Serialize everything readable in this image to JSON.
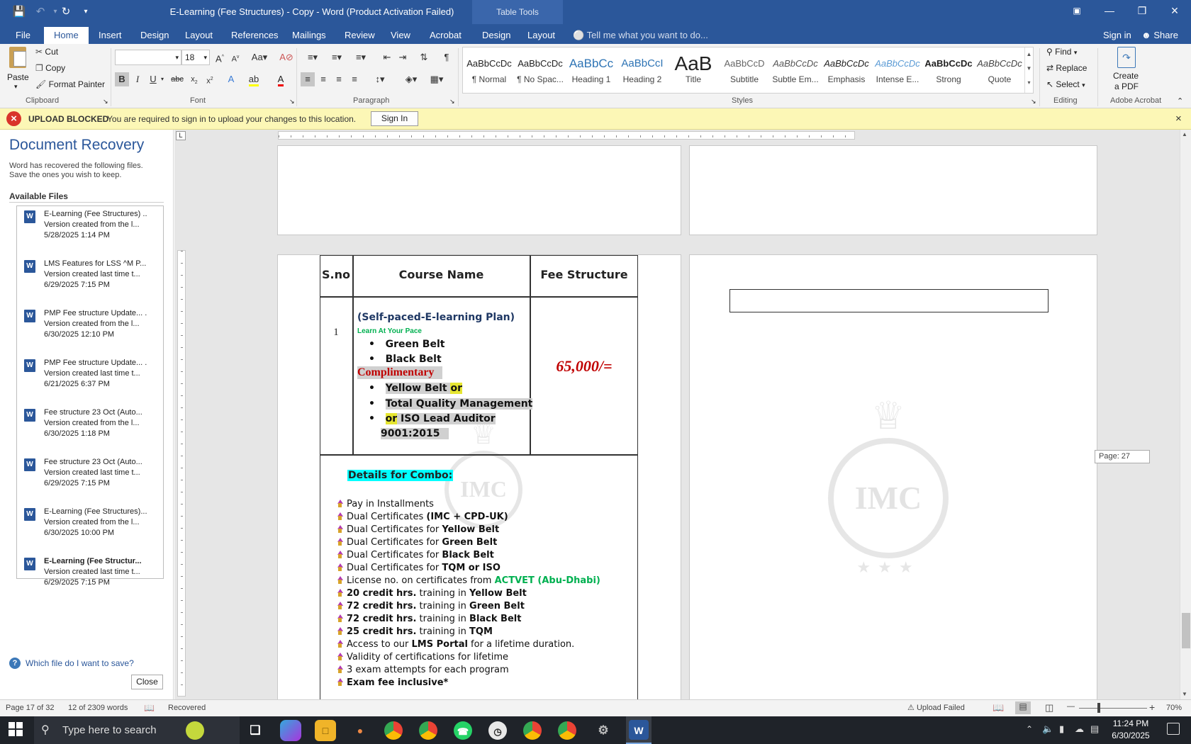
{
  "window": {
    "title": "E-Learning (Fee Structures) - Copy - Word (Product Activation Failed)",
    "table_tools": "Table Tools"
  },
  "tabs": [
    "File",
    "Home",
    "Insert",
    "Design",
    "Layout",
    "References",
    "Mailings",
    "Review",
    "View",
    "Acrobat",
    "Design",
    "Layout"
  ],
  "tell_me": "Tell me what you want to do...",
  "sign_in": "Sign in",
  "share": "Share",
  "clipboard": {
    "paste": "Paste",
    "cut": "Cut",
    "copy": "Copy",
    "format_painter": "Format Painter",
    "label": "Clipboard"
  },
  "font": {
    "name": "",
    "size": "18",
    "label": "Font"
  },
  "paragraph": {
    "label": "Paragraph"
  },
  "styles": {
    "label": "Styles",
    "items": [
      {
        "preview": "AaBbCcDc",
        "name": "¶ Normal"
      },
      {
        "preview": "AaBbCcDc",
        "name": "¶ No Spac..."
      },
      {
        "preview": "AaBbCc",
        "name": "Heading 1"
      },
      {
        "preview": "AaBbCcI",
        "name": "Heading 2"
      },
      {
        "preview": "AaB",
        "name": "Title"
      },
      {
        "preview": "AaBbCcD",
        "name": "Subtitle"
      },
      {
        "preview": "AaBbCcDc",
        "name": "Subtle Em..."
      },
      {
        "preview": "AaBbCcDc",
        "name": "Emphasis"
      },
      {
        "preview": "AaBbCcDc",
        "name": "Intense E..."
      },
      {
        "preview": "AaBbCcDc",
        "name": "Strong"
      },
      {
        "preview": "AaBbCcDc",
        "name": "Quote"
      }
    ]
  },
  "editing": {
    "find": "Find",
    "replace": "Replace",
    "select": "Select",
    "label": "Editing"
  },
  "acrobat": {
    "create1": "Create",
    "create2": "a PDF",
    "label": "Adobe Acrobat"
  },
  "message_bar": {
    "title": "UPLOAD BLOCKED",
    "text": "You are required to sign in to upload your changes to this location.",
    "button": "Sign In"
  },
  "recovery": {
    "title": "Document Recovery",
    "desc1": "Word has recovered the following files.",
    "desc2": "Save the ones you wish to keep.",
    "available": "Available Files",
    "files": [
      {
        "name": "E-Learning (Fee Structures) ..",
        "desc": "Version created from the l...",
        "date": "5/28/2025 1:14 PM",
        "bold": false
      },
      {
        "name": "LMS Features for LSS ^M P...",
        "desc": "Version created last time t...",
        "date": "6/29/2025 7:15 PM",
        "bold": false
      },
      {
        "name": "PMP Fee structure Update... .",
        "desc": "Version created from the l...",
        "date": "6/30/2025 12:10 PM",
        "bold": false
      },
      {
        "name": "PMP Fee structure Update... .",
        "desc": "Version created last time t...",
        "date": "6/21/2025 6:37 PM",
        "bold": false
      },
      {
        "name": "Fee structure 23 Oct (Auto...",
        "desc": "Version created from the l...",
        "date": "6/30/2025 1:18 PM",
        "bold": false
      },
      {
        "name": "Fee structure 23 Oct (Auto...",
        "desc": "Version created last time t...",
        "date": "6/29/2025 7:15 PM",
        "bold": false
      },
      {
        "name": "E-Learning (Fee Structures)...",
        "desc": "Version created from the l...",
        "date": "6/30/2025 10:00 PM",
        "bold": false
      },
      {
        "name": "E-Learning (Fee Structur...",
        "desc": "Version created last time t...",
        "date": "6/29/2025 7:15 PM",
        "bold": true
      }
    ],
    "help": "Which file do I want to save?",
    "close": "Close"
  },
  "document": {
    "headers": [
      "S.no",
      "Course Name",
      "Fee Structure"
    ],
    "row1": {
      "sno": "1",
      "plan": "(Self-paced-E-learning Plan)",
      "tagline": "Learn At Your Pace",
      "belts": [
        "Green Belt",
        "Black Belt"
      ],
      "complimentary": "Complimentary",
      "comp_items": [
        {
          "text": "Yellow Belt ",
          "hl": "or"
        },
        {
          "text": "Total Quality Management",
          "hl": ""
        },
        {
          "text": " ISO Lead Auditor",
          "hl": "or"
        }
      ],
      "comp_cont": "9001:2015",
      "fee": "65,000/="
    },
    "combo_title": "Details for Combo:",
    "combo": [
      [
        {
          "t": "Pay in Installments",
          "b": false
        }
      ],
      [
        {
          "t": "Dual Certificates ",
          "b": false
        },
        {
          "t": "(IMC + CPD-UK)",
          "b": true
        }
      ],
      [
        {
          "t": "Dual Certificates for ",
          "b": false
        },
        {
          "t": "Yellow Belt",
          "b": true
        }
      ],
      [
        {
          "t": "Dual Certificates for ",
          "b": false
        },
        {
          "t": "Green Belt",
          "b": true
        }
      ],
      [
        {
          "t": "Dual Certificates for ",
          "b": false
        },
        {
          "t": "Black Belt",
          "b": true
        }
      ],
      [
        {
          "t": "Dual Certificates for ",
          "b": false
        },
        {
          "t": "TQM or ISO",
          "b": true
        }
      ],
      [
        {
          "t": "License no. on certificates from ",
          "b": false
        },
        {
          "t": "ACTVET (Abu-Dhabi)",
          "b": true,
          "g": true
        }
      ],
      [
        {
          "t": "20 credit hrs.",
          "b": true
        },
        {
          "t": " training in ",
          "b": false
        },
        {
          "t": "Yellow Belt",
          "b": true
        }
      ],
      [
        {
          "t": "72 credit hrs.",
          "b": true
        },
        {
          "t": " training in ",
          "b": false
        },
        {
          "t": "Green Belt",
          "b": true
        }
      ],
      [
        {
          "t": "72 credit hrs.",
          "b": true
        },
        {
          "t": " training in ",
          "b": false
        },
        {
          "t": "Black Belt",
          "b": true
        }
      ],
      [
        {
          "t": "25 credit hrs.",
          "b": true
        },
        {
          "t": " training in ",
          "b": false
        },
        {
          "t": "TQM",
          "b": true
        }
      ],
      [
        {
          "t": "Access to our ",
          "b": false
        },
        {
          "t": "LMS Portal",
          "b": true
        },
        {
          "t": " for a lifetime duration.",
          "b": false
        }
      ],
      [
        {
          "t": "Validity of certifications for lifetime",
          "b": false
        }
      ],
      [
        {
          "t": "3 exam attempts for each program",
          "b": false
        }
      ],
      [
        {
          "t": "Exam fee inclusive*",
          "b": true
        }
      ]
    ],
    "watermark": "IMC",
    "page_tooltip": "Page: 27"
  },
  "status": {
    "page": "Page 17 of 32",
    "words": "12 of 2309 words",
    "recovered": "Recovered",
    "upload": "Upload Failed",
    "zoom": "70%"
  },
  "taskbar": {
    "search": "Type here to search",
    "time": "11:24 PM",
    "date": "6/30/2025"
  },
  "colors": {
    "accent": "#2b579a",
    "message_bg": "#fcf7b6",
    "fee_red": "#c00000",
    "combo_cyan": "#00ffff",
    "green": "#00b050"
  }
}
